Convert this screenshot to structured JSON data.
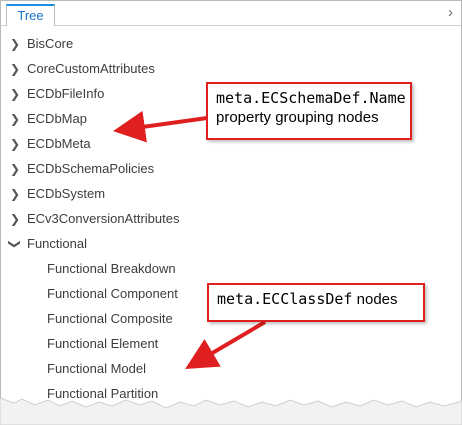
{
  "tab": {
    "label": "Tree"
  },
  "tree": {
    "groups": [
      {
        "label": "BisCore",
        "expanded": false
      },
      {
        "label": "CoreCustomAttributes",
        "expanded": false
      },
      {
        "label": "ECDbFileInfo",
        "expanded": false
      },
      {
        "label": "ECDbMap",
        "expanded": false
      },
      {
        "label": "ECDbMeta",
        "expanded": false
      },
      {
        "label": "ECDbSchemaPolicies",
        "expanded": false
      },
      {
        "label": "ECDbSystem",
        "expanded": false
      },
      {
        "label": "ECv3ConversionAttributes",
        "expanded": false
      },
      {
        "label": "Functional",
        "expanded": true
      }
    ],
    "children": [
      {
        "label": "Functional Breakdown"
      },
      {
        "label": "Functional Component"
      },
      {
        "label": "Functional Composite"
      },
      {
        "label": "Functional Element"
      },
      {
        "label": "Functional Model"
      },
      {
        "label": "Functional Partition"
      }
    ]
  },
  "callouts": {
    "schema": {
      "code": "meta.ECSchemaDef.Name",
      "text": "property grouping nodes"
    },
    "class": {
      "code": "meta.ECClassDef",
      "text": " nodes"
    }
  },
  "colors": {
    "accent": "#1a8ee0",
    "annotation": "#e02020"
  }
}
